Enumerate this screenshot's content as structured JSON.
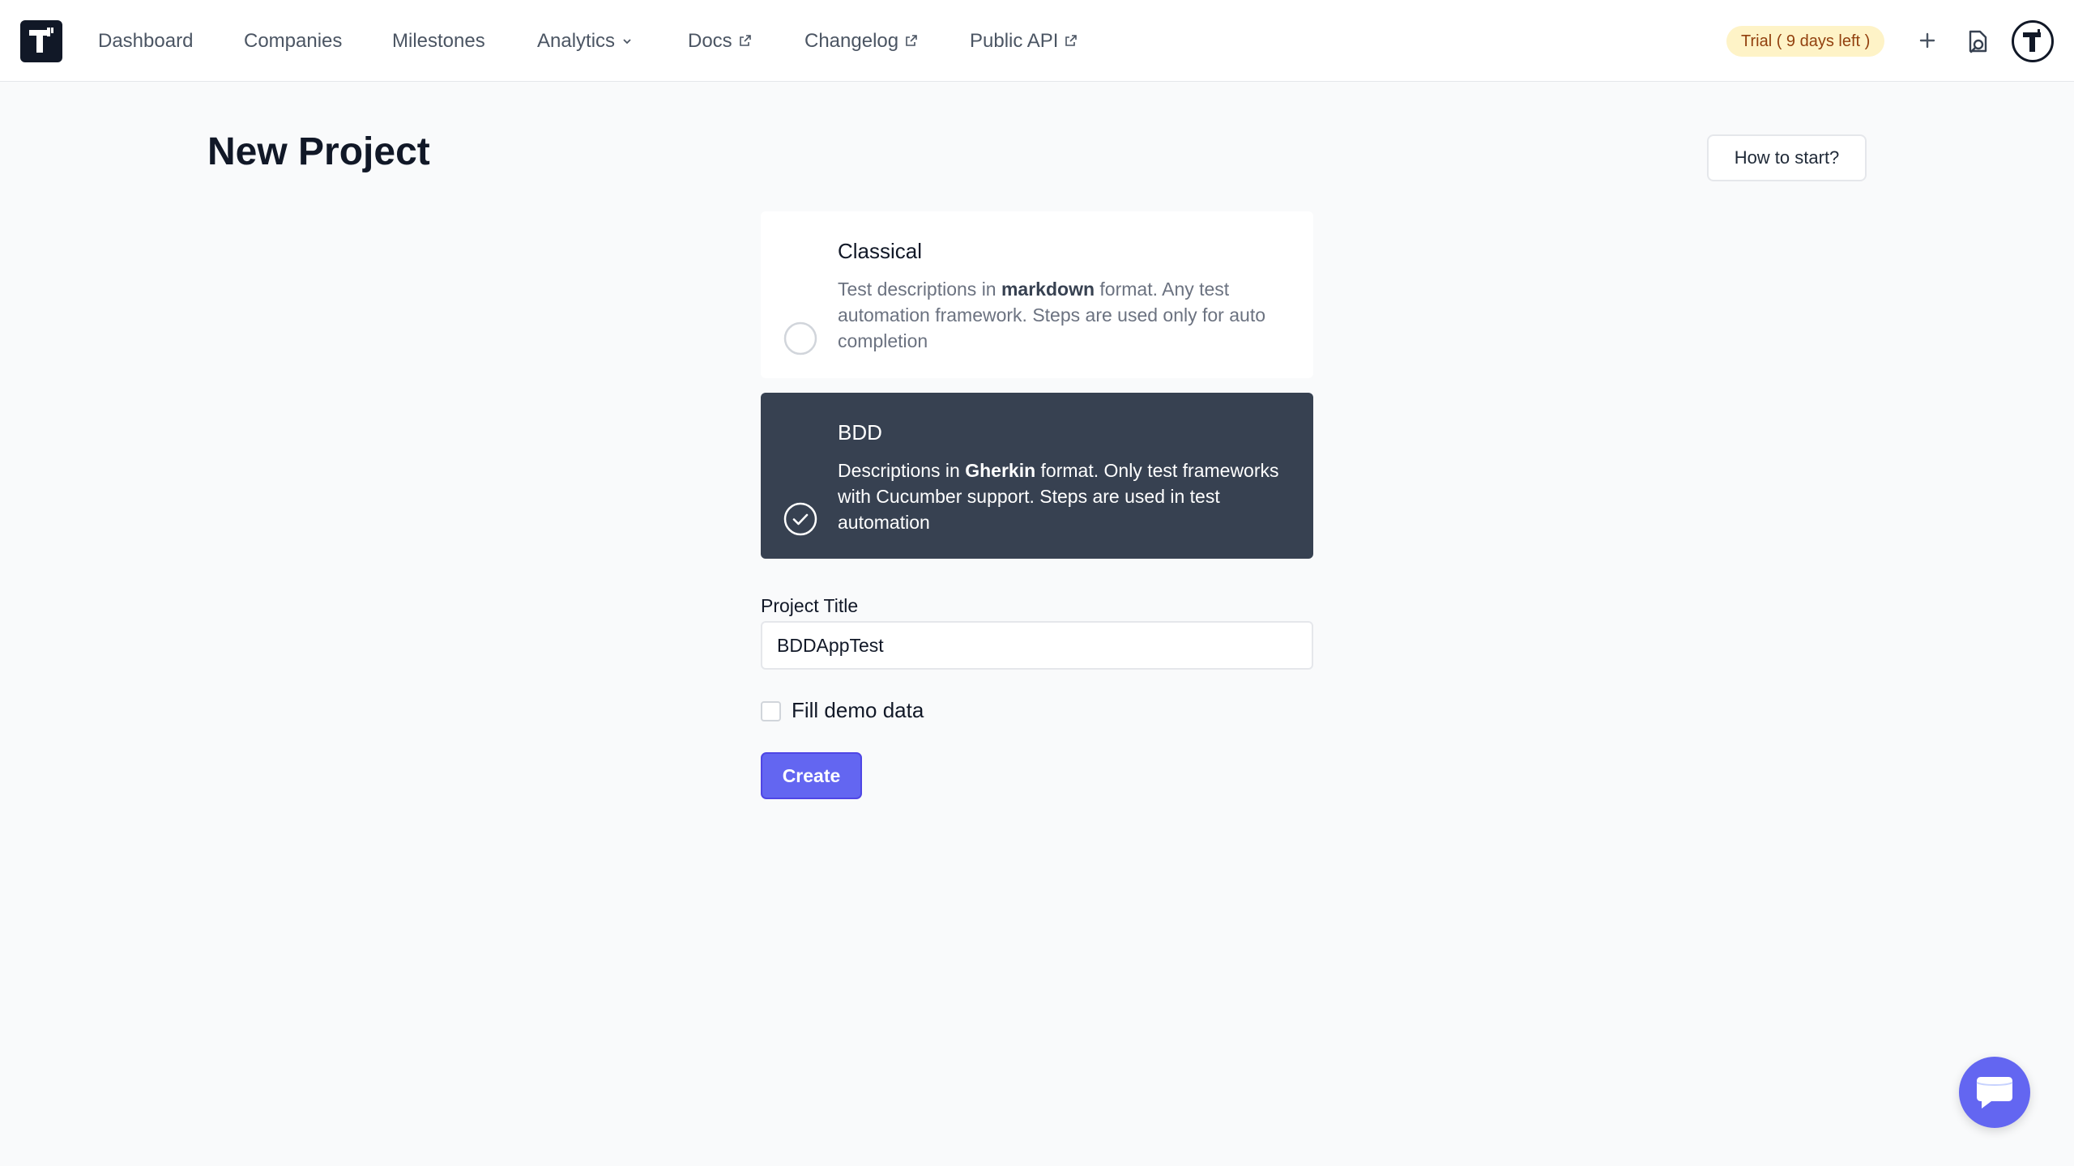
{
  "nav": {
    "items": [
      {
        "label": "Dashboard",
        "icon": ""
      },
      {
        "label": "Companies",
        "icon": ""
      },
      {
        "label": "Milestones",
        "icon": ""
      },
      {
        "label": "Analytics",
        "icon": "chevron-down-icon"
      },
      {
        "label": "Docs",
        "icon": "external-link-icon"
      },
      {
        "label": "Changelog",
        "icon": "external-link-icon"
      },
      {
        "label": "Public API",
        "icon": "external-link-icon"
      }
    ],
    "trial_badge": "Trial ( 9 days left )"
  },
  "page": {
    "title": "New Project",
    "how_to_start": "How to start?"
  },
  "project_types": {
    "classical": {
      "title": "Classical",
      "desc_before": "Test descriptions in ",
      "desc_bold": "markdown",
      "desc_after": " format. Any test automation framework. Steps are used only for auto completion",
      "selected": false
    },
    "bdd": {
      "title": "BDD",
      "desc_before": "Descriptions in ",
      "desc_bold": "Gherkin",
      "desc_after": " format. Only test frameworks with Cucumber support. Steps are used in test automation",
      "selected": true
    }
  },
  "form": {
    "title_label": "Project Title",
    "title_value": "BDDAppTest",
    "demo_label": "Fill demo data",
    "demo_checked": false,
    "create_label": "Create"
  },
  "colors": {
    "accent": "#6366f1",
    "selected_card": "#374151",
    "trial_bg": "#fef3c7",
    "trial_text": "#92400e"
  }
}
